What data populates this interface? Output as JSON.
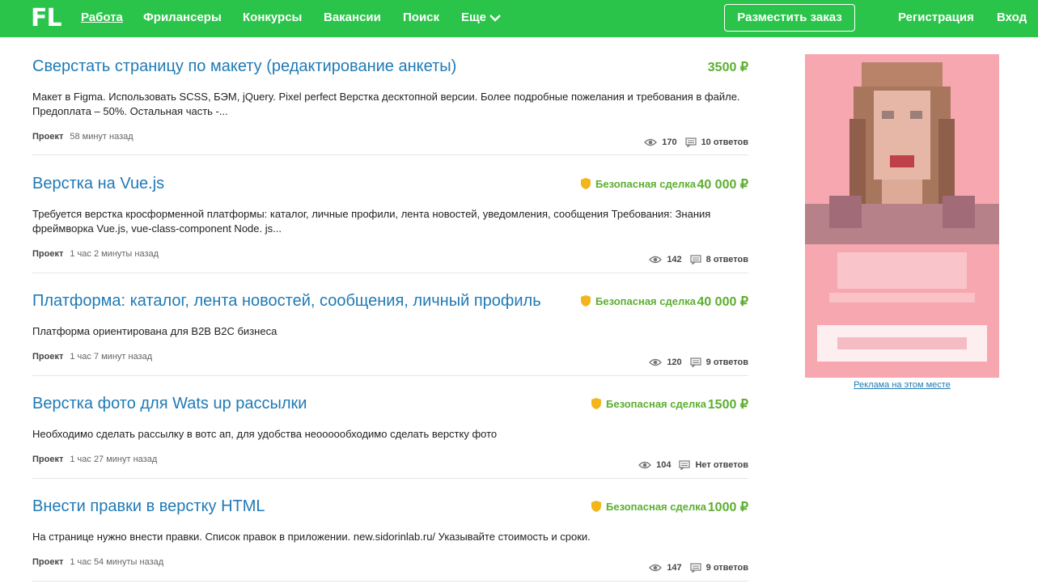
{
  "header": {
    "logo": "FL",
    "nav": [
      {
        "label": "Работа",
        "active": true
      },
      {
        "label": "Фрилансеры"
      },
      {
        "label": "Конкурсы"
      },
      {
        "label": "Вакансии"
      },
      {
        "label": "Поиск"
      },
      {
        "label": "Еще"
      }
    ],
    "post_button": "Разместить заказ",
    "register": "Регистрация",
    "login": "Вход"
  },
  "projects": [
    {
      "title": "Сверстать страницу по макету (редактирование анкеты)",
      "price": "3500 ₽",
      "safe_deal": "",
      "description": "Макет в Figma. Использовать SCSS, БЭМ, jQuery. Pixel perfect Верстка десктопной версии.  Более подробные пожелания и требования в файле. Предоплата – 50%. Остальная часть -...",
      "type": "Проект",
      "time": "58 минут назад",
      "views": "170",
      "answers": "10 ответов"
    },
    {
      "title": "Верстка на Vue.js",
      "price": "40 000 ₽",
      "safe_deal": "Безопасная сделка",
      "description": "Требуется верстка кросформенной платформы: каталог, личные профили, лента новостей, уведомления, сообщения Требования: Знания фреймворка Vue.js, vue-class-component Node. js...",
      "type": "Проект",
      "time": "1 час 2 минуты назад",
      "views": "142",
      "answers": "8 ответов"
    },
    {
      "title": "Платформа: каталог, лента новостей, сообщения, личный профиль",
      "price": "40 000 ₽",
      "safe_deal": "Безопасная сделка",
      "description": "Платформа ориентирована для B2B B2C бизнеса",
      "type": "Проект",
      "time": "1 час 7 минут назад",
      "views": "120",
      "answers": "9 ответов"
    },
    {
      "title": "Верстка фото для Wats up рассылки",
      "price": "1500 ₽",
      "safe_deal": "Безопасная сделка",
      "description": "Необходимо сделать рассылку в вотс ап, для удобства неоооообходимо сделать верстку фото",
      "type": "Проект",
      "time": "1 час 27 минут назад",
      "views": "104",
      "answers": "Нет ответов"
    },
    {
      "title": "Внести правки в верстку HTML",
      "price": "1000 ₽",
      "safe_deal": "Безопасная сделка",
      "description": "На странице нужно внести правки. Список правок в приложении.  new.sidorinlab.ru/ Указывайте стоимость и сроки.",
      "type": "Проект",
      "time": "1 час 54 минуты назад",
      "views": "147",
      "answers": "9 ответов"
    }
  ],
  "ad": {
    "link_text": "Реклама на этом месте"
  },
  "colors": {
    "brand_green": "#2bc44a",
    "title_blue": "#1f7ab5",
    "price_green": "#5cae30",
    "shield_yellow": "#f3b51c",
    "ad_pink": "#f7a7b0"
  },
  "icons": [
    "chevron-down-icon",
    "shield-icon",
    "eye-icon",
    "comment-icon"
  ]
}
